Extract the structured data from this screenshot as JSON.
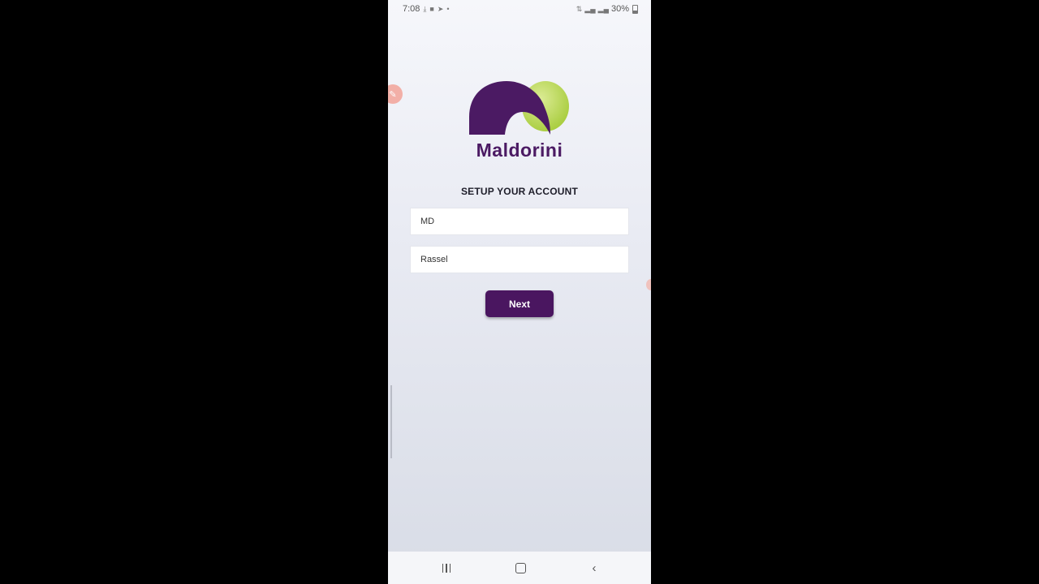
{
  "status_bar": {
    "time": "7:08",
    "battery": "30%"
  },
  "app": {
    "brand_name": "Maldorini",
    "colors": {
      "brand_purple": "#4b1a63",
      "brand_green": "#b7d655",
      "button": "#4a1660"
    }
  },
  "setup": {
    "title": "SETUP YOUR ACCOUNT",
    "first_name_value": "MD",
    "last_name_value": "Rassel",
    "next_label": "Next"
  },
  "nav_bar": {
    "recents_icon": "recents-icon",
    "home_icon": "home-icon",
    "back_icon": "back-icon"
  }
}
